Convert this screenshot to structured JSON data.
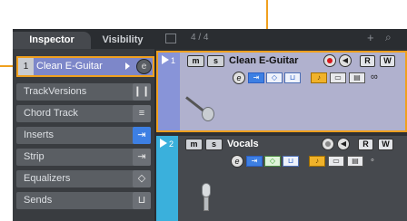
{
  "inspector": {
    "tabs": [
      {
        "label": "Inspector",
        "active": true
      },
      {
        "label": "Visibility",
        "active": false
      }
    ],
    "selected_track": {
      "number": "1",
      "name": "Clean E-Guitar"
    },
    "sections": [
      {
        "label": "TrackVersions",
        "icon": "track-versions-icon"
      },
      {
        "label": "Chord Track",
        "icon": "chord-track-icon"
      },
      {
        "label": "Inserts",
        "icon": "inserts-icon",
        "active": true
      },
      {
        "label": "Strip",
        "icon": "strip-icon"
      },
      {
        "label": "Equalizers",
        "icon": "equalizer-icon"
      },
      {
        "label": "Sends",
        "icon": "sends-icon"
      }
    ]
  },
  "project": {
    "time_signature": "4 / 4",
    "tracks": [
      {
        "number": "1",
        "name": "Clean E-Guitar",
        "mute": "m",
        "solo": "s",
        "read": "R",
        "write": "W",
        "edit": "e",
        "selected": true,
        "color": "#8894d8",
        "instrument": "guitar-icon"
      },
      {
        "number": "2",
        "name": "Vocals",
        "mute": "m",
        "solo": "s",
        "read": "R",
        "write": "W",
        "edit": "e",
        "selected": false,
        "color": "#3ab0dc",
        "instrument": "microphone-icon"
      }
    ]
  },
  "colors": {
    "highlight_orange": "#f0a01e",
    "selected_header_blue": "#7d87c9",
    "active_blue": "#3d7fe3",
    "record_red": "#d8171c"
  }
}
